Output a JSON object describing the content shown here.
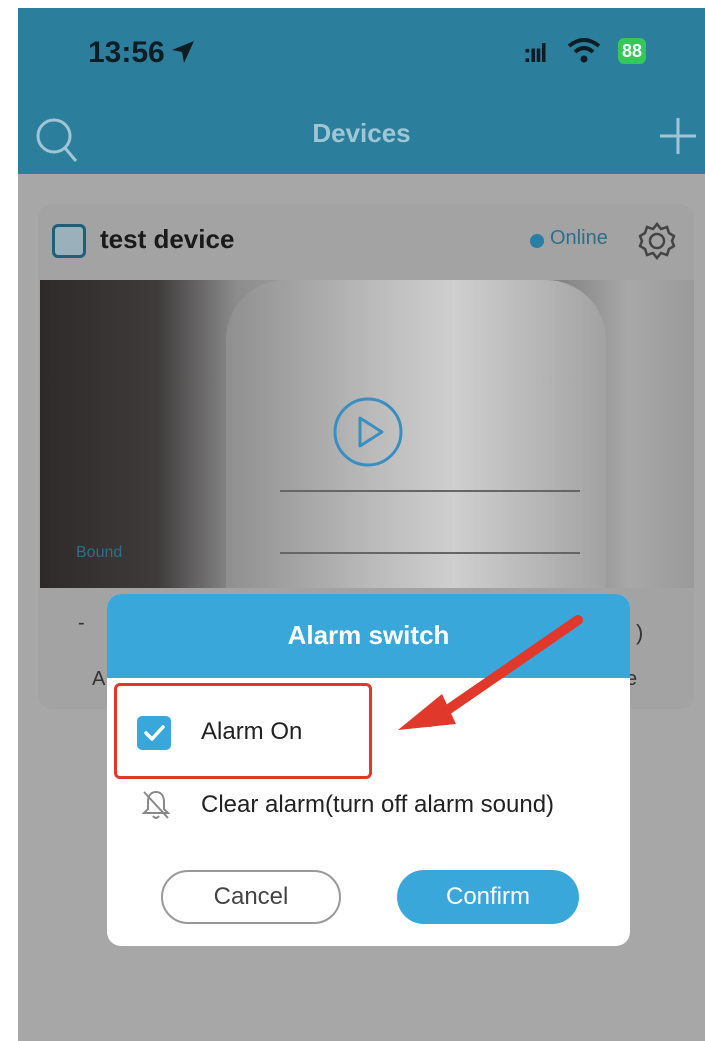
{
  "status_bar": {
    "time": "13:56",
    "signal": ":ııl",
    "battery": "88"
  },
  "header": {
    "title": "Devices"
  },
  "device": {
    "name": "test device",
    "status": "Online",
    "preview_badge": "Bound"
  },
  "background_text": {
    "left_top": "-",
    "left_bottom": "A",
    "right_top": ")",
    "right_bottom": "e"
  },
  "dialog": {
    "title": "Alarm switch",
    "option_alarm_on": "Alarm On",
    "alarm_on_checked": true,
    "option_clear": "Clear alarm(turn off alarm sound)",
    "cancel_label": "Cancel",
    "confirm_label": "Confirm"
  },
  "colors": {
    "header": "#2c7f9c",
    "accent": "#3aa7da",
    "highlight": "#e0382a",
    "online": "#2a7fa5"
  },
  "icons": [
    "location-arrow-icon",
    "wifi-icon",
    "search-icon",
    "plus-icon",
    "device-icon",
    "gear-icon",
    "play-icon",
    "check-icon",
    "bell-off-icon",
    "arrow-annotation"
  ]
}
